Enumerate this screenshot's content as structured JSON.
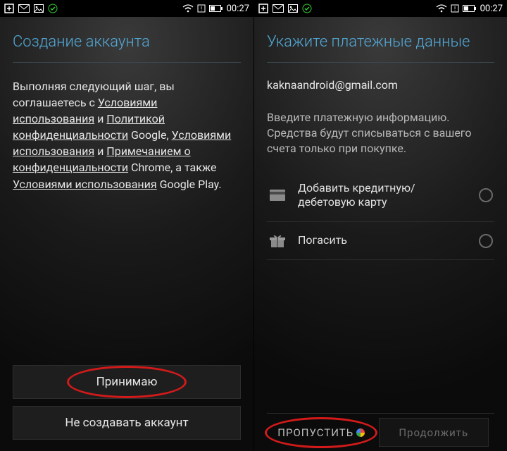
{
  "statusbar": {
    "time": "00:27"
  },
  "left": {
    "title": "Создание аккаунта",
    "para_prefix": "Выполняя следующий шаг, вы соглашаетесь с ",
    "link_tos": "Условиями использования",
    "and1": " и ",
    "link_privacy": "Политикой конфиденциальности",
    "after_privacy": " Google, ",
    "link_chrome_tos": "Условиями использования",
    "and2": " и ",
    "link_chrome_privacy": "Примечанием о конфиденциальности",
    "after_chrome": " Chrome, а также ",
    "link_play_tos": "Условиями использования",
    "after_play": " Google Play.",
    "accept": "Принимаю",
    "decline": "Не создавать аккаунт"
  },
  "right": {
    "title": "Укажите платежные данные",
    "email": "kaknaandroid@gmail.com",
    "info": "Введите платежную информацию. Средства будут списываться с вашего счета только при покупке.",
    "opt_card": "Добавить кредитную/дебетовую карту",
    "opt_redeem": "Погасить",
    "skip": "ПРОПУСТИТЬ",
    "continue": "Продолжить"
  }
}
